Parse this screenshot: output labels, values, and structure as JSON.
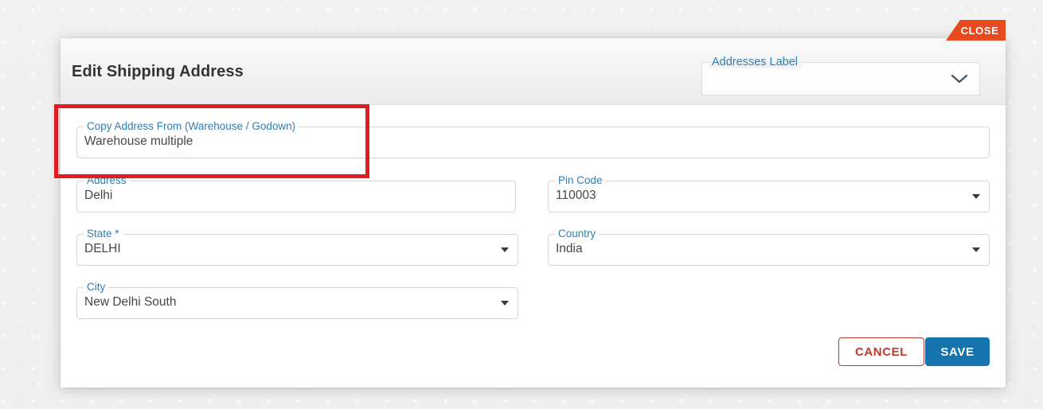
{
  "window": {
    "background_color": "#f0f0f0"
  },
  "modal": {
    "title": "Edit Shipping Address",
    "close_button": {
      "label": "CLOSE",
      "color": "#e8491f"
    },
    "header_field": {
      "label": "Addresses Label",
      "value": "",
      "icon": "chevron-down-icon"
    },
    "fields": [
      {
        "key": "copy_address_from",
        "label": "Copy Address From (Warehouse / Godown)",
        "value": "Warehouse multiple",
        "type": "text"
      },
      {
        "key": "address",
        "label": "Address",
        "value": "Delhi",
        "type": "text"
      },
      {
        "key": "pin_code",
        "label": "Pin Code",
        "value": "110003",
        "type": "select"
      },
      {
        "key": "state",
        "label": "State *",
        "value": "DELHI",
        "type": "select"
      },
      {
        "key": "country",
        "label": "Country",
        "value": "India",
        "type": "select"
      },
      {
        "key": "city",
        "label": "City",
        "value": "New Delhi South",
        "type": "select"
      }
    ],
    "actions": {
      "cancel_label": "CANCEL",
      "save_label": "SAVE",
      "cancel_color": "#c0392b",
      "save_color": "#1573ad"
    }
  },
  "annotation": {
    "highlight_color": "#e01b22",
    "target": "copy_address_from"
  }
}
